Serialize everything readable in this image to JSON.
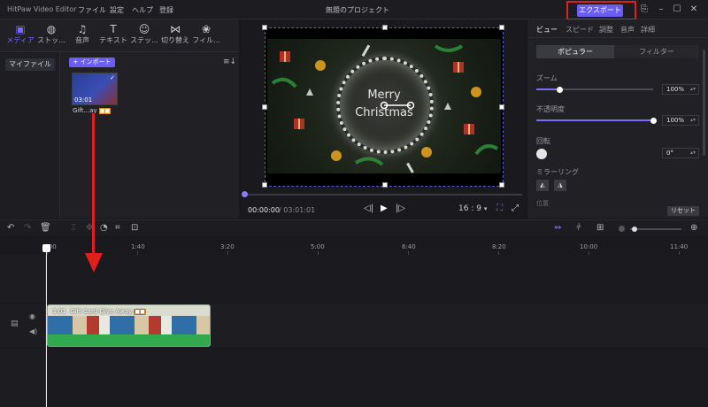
{
  "app": {
    "name": "HitPaw Video Editor",
    "menu": [
      "ファイル",
      "設定",
      "ヘルプ",
      "登録"
    ],
    "project_title": "無題のプロジェクト",
    "export_label": "エクスポート"
  },
  "media_tabs": [
    {
      "label": "メディア",
      "icon": "media-icon"
    },
    {
      "label": "ストッ...",
      "icon": "stock-globe-icon"
    },
    {
      "label": "音声",
      "icon": "music-note-icon"
    },
    {
      "label": "テキスト",
      "icon": "text-icon"
    },
    {
      "label": "ステッ...",
      "icon": "sticker-smiley-icon"
    },
    {
      "label": "切り替え",
      "icon": "transition-icon"
    },
    {
      "label": "フィル...",
      "icon": "filter-icon"
    }
  ],
  "left_nav": {
    "my_files": "マイファイル"
  },
  "media_bin": {
    "import_label": "+ インポート",
    "item": {
      "duration": "03:01",
      "label": "Gift...ay"
    }
  },
  "preview": {
    "overlay_text_line1": "Merry",
    "overlay_text_line2": "Christmas",
    "time_current": "00:00:00",
    "time_total": "/ 03:01:01",
    "aspect": "16 : 9",
    "progress": 0
  },
  "right_panel": {
    "tabs": [
      "ビュー",
      "スピード",
      "調整",
      "音声",
      "詳細"
    ],
    "segments": [
      "ポピュラー",
      "フィルター"
    ],
    "zoom": {
      "label": "ズーム",
      "value": "100%",
      "level": 0.2
    },
    "opacity": {
      "label": "不透明度",
      "value": "100%",
      "level": 1.0
    },
    "rotation": {
      "label": "回転",
      "value": "0°"
    },
    "mirror": {
      "label": "ミラーリング"
    },
    "cut_label": "位置",
    "reset_label": "リセット"
  },
  "timeline": {
    "ticks": [
      "0:00",
      "1:40",
      "3:20",
      "5:00",
      "6:40",
      "8:20",
      "10:00",
      "11:40"
    ],
    "clip": {
      "duration": "3:01",
      "title": "Gift Card Give Away"
    }
  },
  "colors": {
    "accent": "#6a5cf5",
    "annotation": "#e01e1e",
    "audio": "#32a94f"
  }
}
